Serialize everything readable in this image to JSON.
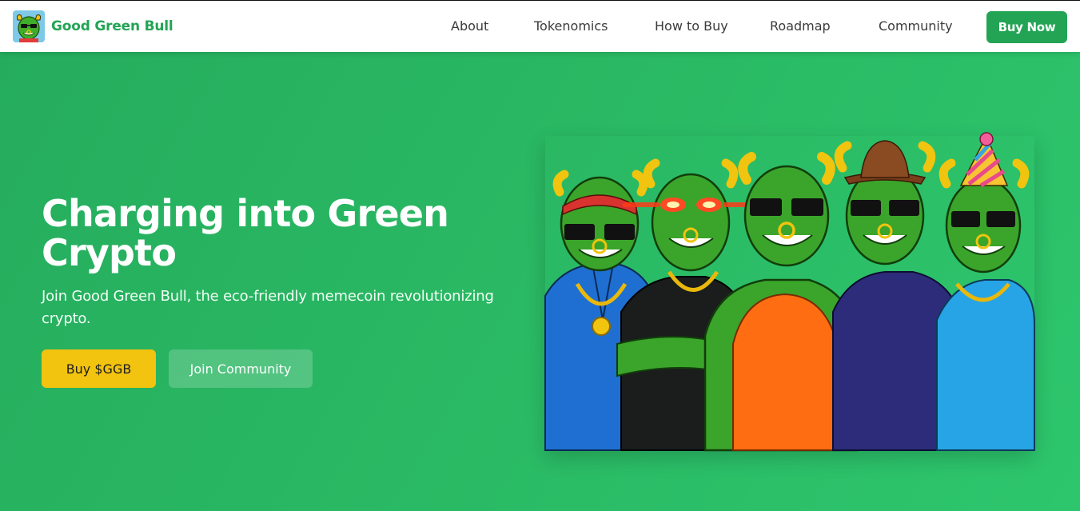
{
  "brand": {
    "name": "Good Green Bull",
    "logo_icon": "bull-logo-icon"
  },
  "nav": {
    "links": [
      "About",
      "Tokenomics",
      "How to Buy",
      "Roadmap",
      "Community"
    ],
    "cta": "Buy Now"
  },
  "hero": {
    "title": "Charging into Green Crypto",
    "subtitle": "Join Good Green Bull, the eco-friendly memecoin revolutionizing crypto.",
    "primary_button": "Buy $GGB",
    "secondary_button": "Join Community",
    "image_icon": "green-bull-gang-illustration"
  },
  "colors": {
    "brand_green": "#23a455",
    "hero_bg": "#2bbb66",
    "buy_yellow": "#f2c30f",
    "white": "#ffffff"
  }
}
